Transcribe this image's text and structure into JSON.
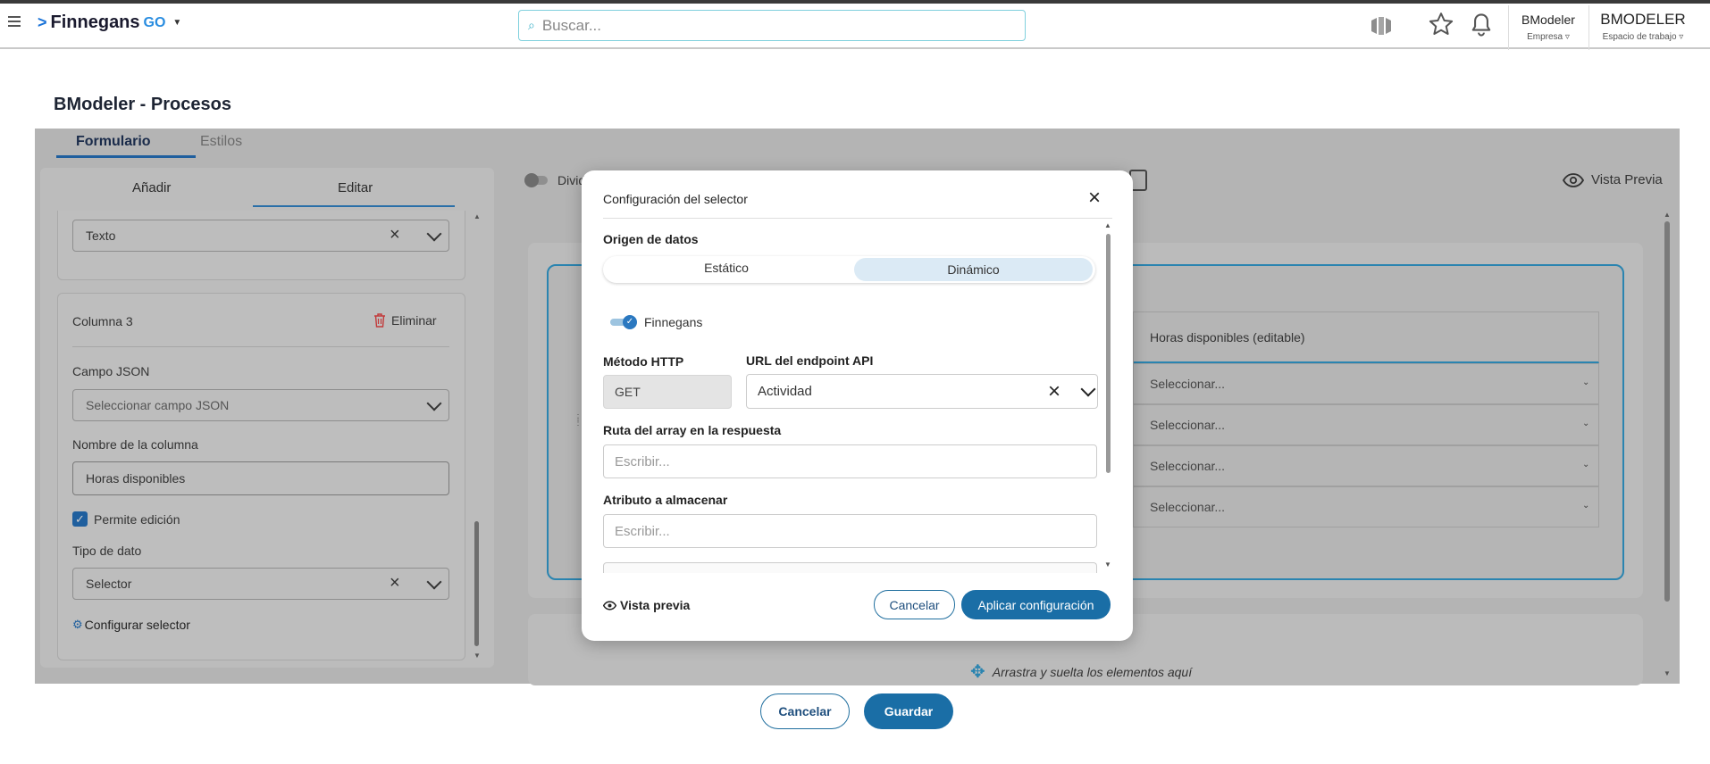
{
  "header": {
    "logo_text": "Finnegans",
    "logo_suffix": "GO",
    "search_placeholder": "Buscar...",
    "company_name": "BModeler",
    "company_label": "Empresa",
    "workspace_name": "BMODELER",
    "workspace_label": "Espacio de trabajo"
  },
  "page": {
    "title": "BModeler - Procesos",
    "tabs": [
      {
        "label": "Formulario"
      },
      {
        "label": "Estilos"
      }
    ]
  },
  "left_panel": {
    "tabs": [
      {
        "label": "Añadir"
      },
      {
        "label": "Editar"
      }
    ],
    "prev_field_value": "Texto",
    "column_title": "Columna 3",
    "delete_label": "Eliminar",
    "json_field_label": "Campo JSON",
    "json_field_placeholder": "Seleccionar campo JSON",
    "column_name_label": "Nombre de la columna",
    "column_name_value": "Horas disponibles",
    "allow_edit_label": "Permite edición",
    "allow_edit_checked": true,
    "data_type_label": "Tipo de dato",
    "data_type_value": "Selector",
    "configure_label": "Configurar selector"
  },
  "canvas": {
    "divide_label": "Divid",
    "preview_label": "Vista Previa",
    "column_header": "Horas disponibles  (editable)",
    "rows": [
      {
        "value": "Seleccionar..."
      },
      {
        "value": "Seleccionar..."
      },
      {
        "value": "Seleccionar..."
      },
      {
        "value": "Seleccionar..."
      }
    ],
    "drop_hint": "Arrastra y suelta los elementos aquí"
  },
  "modal": {
    "title": "Configuración del selector",
    "data_origin_label": "Origen de datos",
    "origin_options": [
      {
        "label": "Estático"
      },
      {
        "label": "Dinámico"
      }
    ],
    "origin_selected": "Dinámico",
    "toggle_label": "Finnegans",
    "method_label": "Método HTTP",
    "method_value": "GET",
    "url_label": "URL del endpoint API",
    "url_value": "Actividad",
    "array_path_label": "Ruta del array en la respuesta",
    "array_path_placeholder": "Escribir...",
    "attribute_label": "Atributo a almacenar",
    "attribute_placeholder": "Escribir...",
    "preview_label": "Vista previa",
    "cancel_label": "Cancelar",
    "apply_label": "Aplicar configuración"
  },
  "footer": {
    "cancel_label": "Cancelar",
    "save_label": "Guardar"
  }
}
